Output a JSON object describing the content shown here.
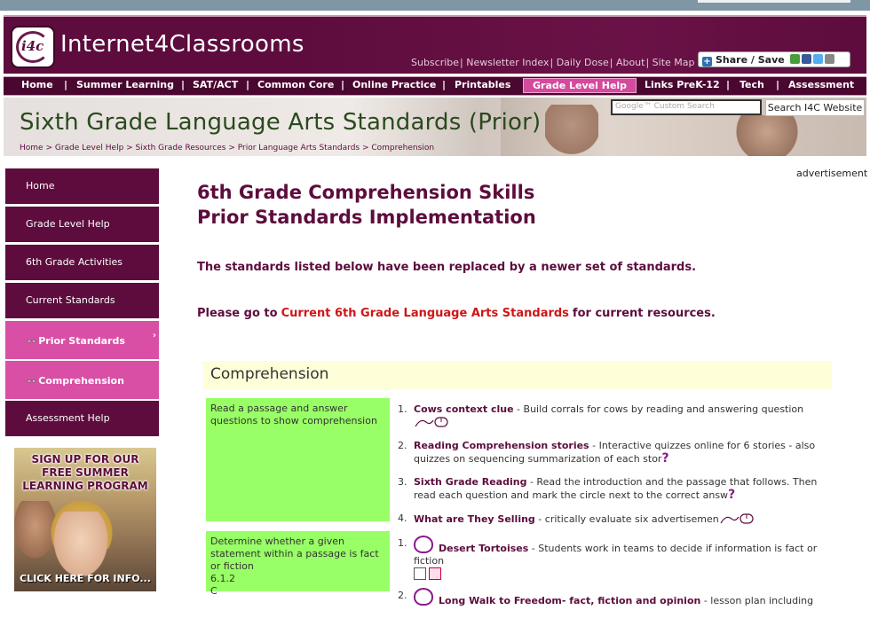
{
  "site": {
    "name": "Internet4Classrooms",
    "logo_text": "i4c"
  },
  "toplinks": [
    "Subscribe",
    "Newsletter Index",
    "Daily Dose",
    "About",
    "Site Map"
  ],
  "share": {
    "label": "Share / Save"
  },
  "nav": [
    {
      "label": "Home"
    },
    {
      "label": "Summer Learning"
    },
    {
      "label": "SAT/ACT"
    },
    {
      "label": "Common Core"
    },
    {
      "label": "Online Practice"
    },
    {
      "label": "Printables"
    },
    {
      "label": "Grade Level Help",
      "active": true
    },
    {
      "label": "Links PreK-12"
    },
    {
      "label": "Tech"
    },
    {
      "label": "Assessment"
    }
  ],
  "banner": {
    "title": "Sixth Grade Language Arts Standards (Prior)",
    "search_placeholder": "Google™ Custom Search",
    "search_button": "Search I4C Website",
    "breadcrumbs": [
      "Home",
      "Grade Level Help",
      "Sixth Grade Resources",
      "Prior Language Arts Standards",
      "Comprehension"
    ]
  },
  "sidebar": [
    {
      "label": "Home"
    },
    {
      "label": "Grade Level Help"
    },
    {
      "label": "6th Grade Activities"
    },
    {
      "label": "Current Standards"
    },
    {
      "label": "Prior Standards",
      "highlight": true
    },
    {
      "label": "Comprehension",
      "highlight": true
    },
    {
      "label": "Assessment Help"
    }
  ],
  "promo": {
    "headline": "SIGN UP FOR OUR FREE SUMMER LEARNING PROGRAM",
    "cta": "CLICK HERE FOR INFO..."
  },
  "advertisement": "advertisement",
  "main": {
    "title_line1": "6th Grade Comprehension Skills",
    "title_line2": "Prior Standards Implementation",
    "notice1": "The standards listed below have been replaced by a newer set of standards.",
    "notice2_pre": "Please go to",
    "notice2_link": "Current 6th Grade Language Arts Standards",
    "notice2_post": "for current resources.",
    "section": "Comprehension",
    "objectives": [
      {
        "text": "Read a passage and answer questions to show comprehension",
        "items": [
          {
            "title": "Cows context clue",
            "desc": " - Build corrals for cows by reading and answering question"
          },
          {
            "title": "Reading Comprehension stories",
            "desc": " - Interactive quizzes online for 6 stories - also quizzes on sequencing summarization of each stor"
          },
          {
            "title": "Sixth Grade Reading",
            "desc": " - Read the introduction and the passage that follows. Then read each question and mark the circle next to the correct answ"
          },
          {
            "title": "What are They Selling",
            "desc": " - critically evaluate six advertisemen"
          }
        ]
      },
      {
        "text": "Determine whether a given statement within a passage is fact or fiction",
        "code": "6.1.2",
        "level": "C",
        "items": [
          {
            "title": "Desert Tortoises",
            "desc": " - Students work in teams to decide if information is fact or fiction"
          },
          {
            "title": "Long Walk to Freedom- fact, fiction and opinion",
            "desc": " - lesson plan including"
          }
        ]
      }
    ]
  }
}
